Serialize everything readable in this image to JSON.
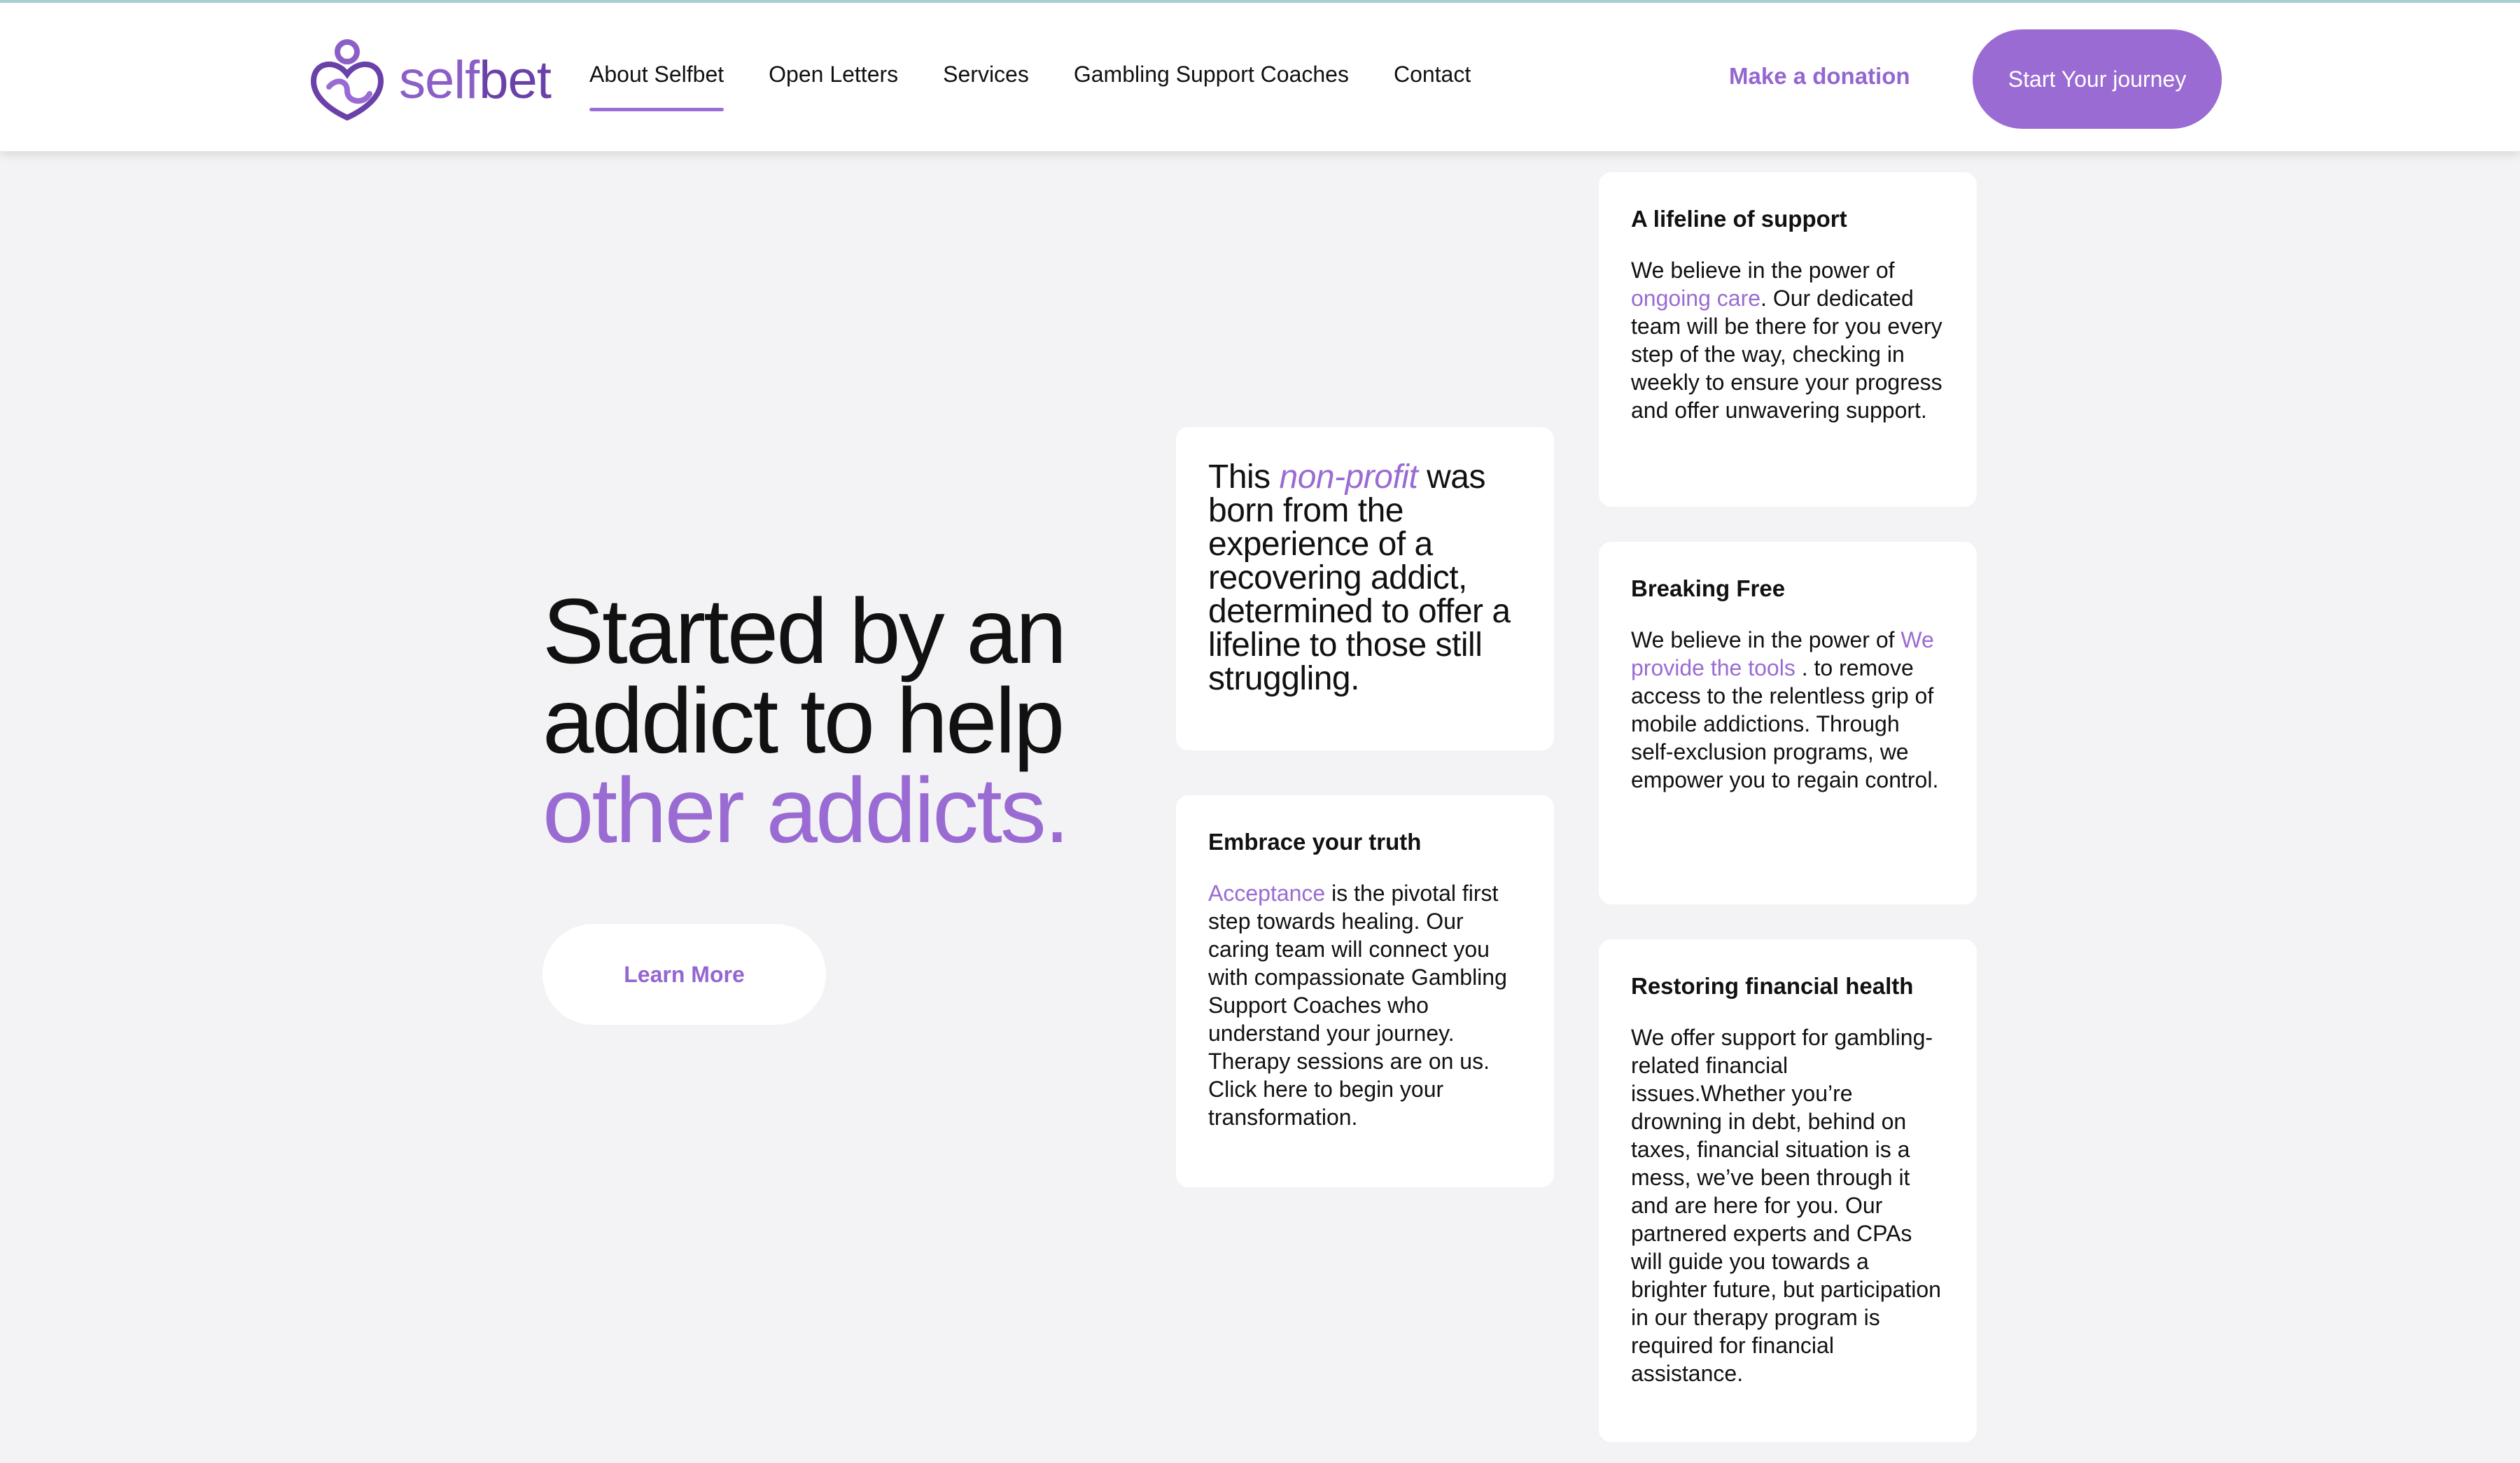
{
  "brand": {
    "name_light": "self",
    "name_bold": "bet",
    "accent_color": "#9a6bd3"
  },
  "nav": {
    "items": [
      {
        "label": "About Selfbet",
        "active": true
      },
      {
        "label": "Open Letters",
        "active": false
      },
      {
        "label": "Services",
        "active": false
      },
      {
        "label": "Gambling Support Coaches",
        "active": false
      },
      {
        "label": "Contact",
        "active": false
      }
    ],
    "donate_label": "Make a donation",
    "journey_label": "Start Your journey"
  },
  "hero": {
    "line1": "Started by an",
    "line2": "addict to help",
    "accent": "other addicts.",
    "learn_more": "Learn More"
  },
  "cards": {
    "nonprofit": {
      "pre": "This ",
      "highlight": "non-profit",
      "post": " was born from the experience of a recovering addict, determined to offer a lifeline to those still struggling."
    },
    "truth": {
      "title": "Embrace your truth",
      "highlight": "Acceptance",
      "body": " is the pivotal first step towards healing. Our caring team will connect you with compassionate Gambling Support Coaches who understand your journey. Therapy sessions are on us. Click here to begin your transformation."
    },
    "lifeline": {
      "title": "A lifeline of support",
      "pre": "We believe in the power of ",
      "highlight": "ongoing care",
      "post": ". Our dedicated team will be there for you every step of the way, checking in weekly to ensure your progress and offer unwavering support."
    },
    "breaking": {
      "title": "Breaking Free",
      "pre": "We believe in the power of ",
      "highlight": "We provide the tools",
      "post": " . to remove access to the relentless grip of mobile addictions. Through self-exclusion programs, we empower you to regain control."
    },
    "finance": {
      "title": "Restoring financial health",
      "body": "We offer support for gambling-related financial issues.Whether you’re drowning in debt, behind on taxes, financial situation is a mess, we’ve been through it and are here for you. Our partnered experts and CPAs will guide you towards a brighter future, but participation in our therapy program is required for financial assistance."
    }
  }
}
